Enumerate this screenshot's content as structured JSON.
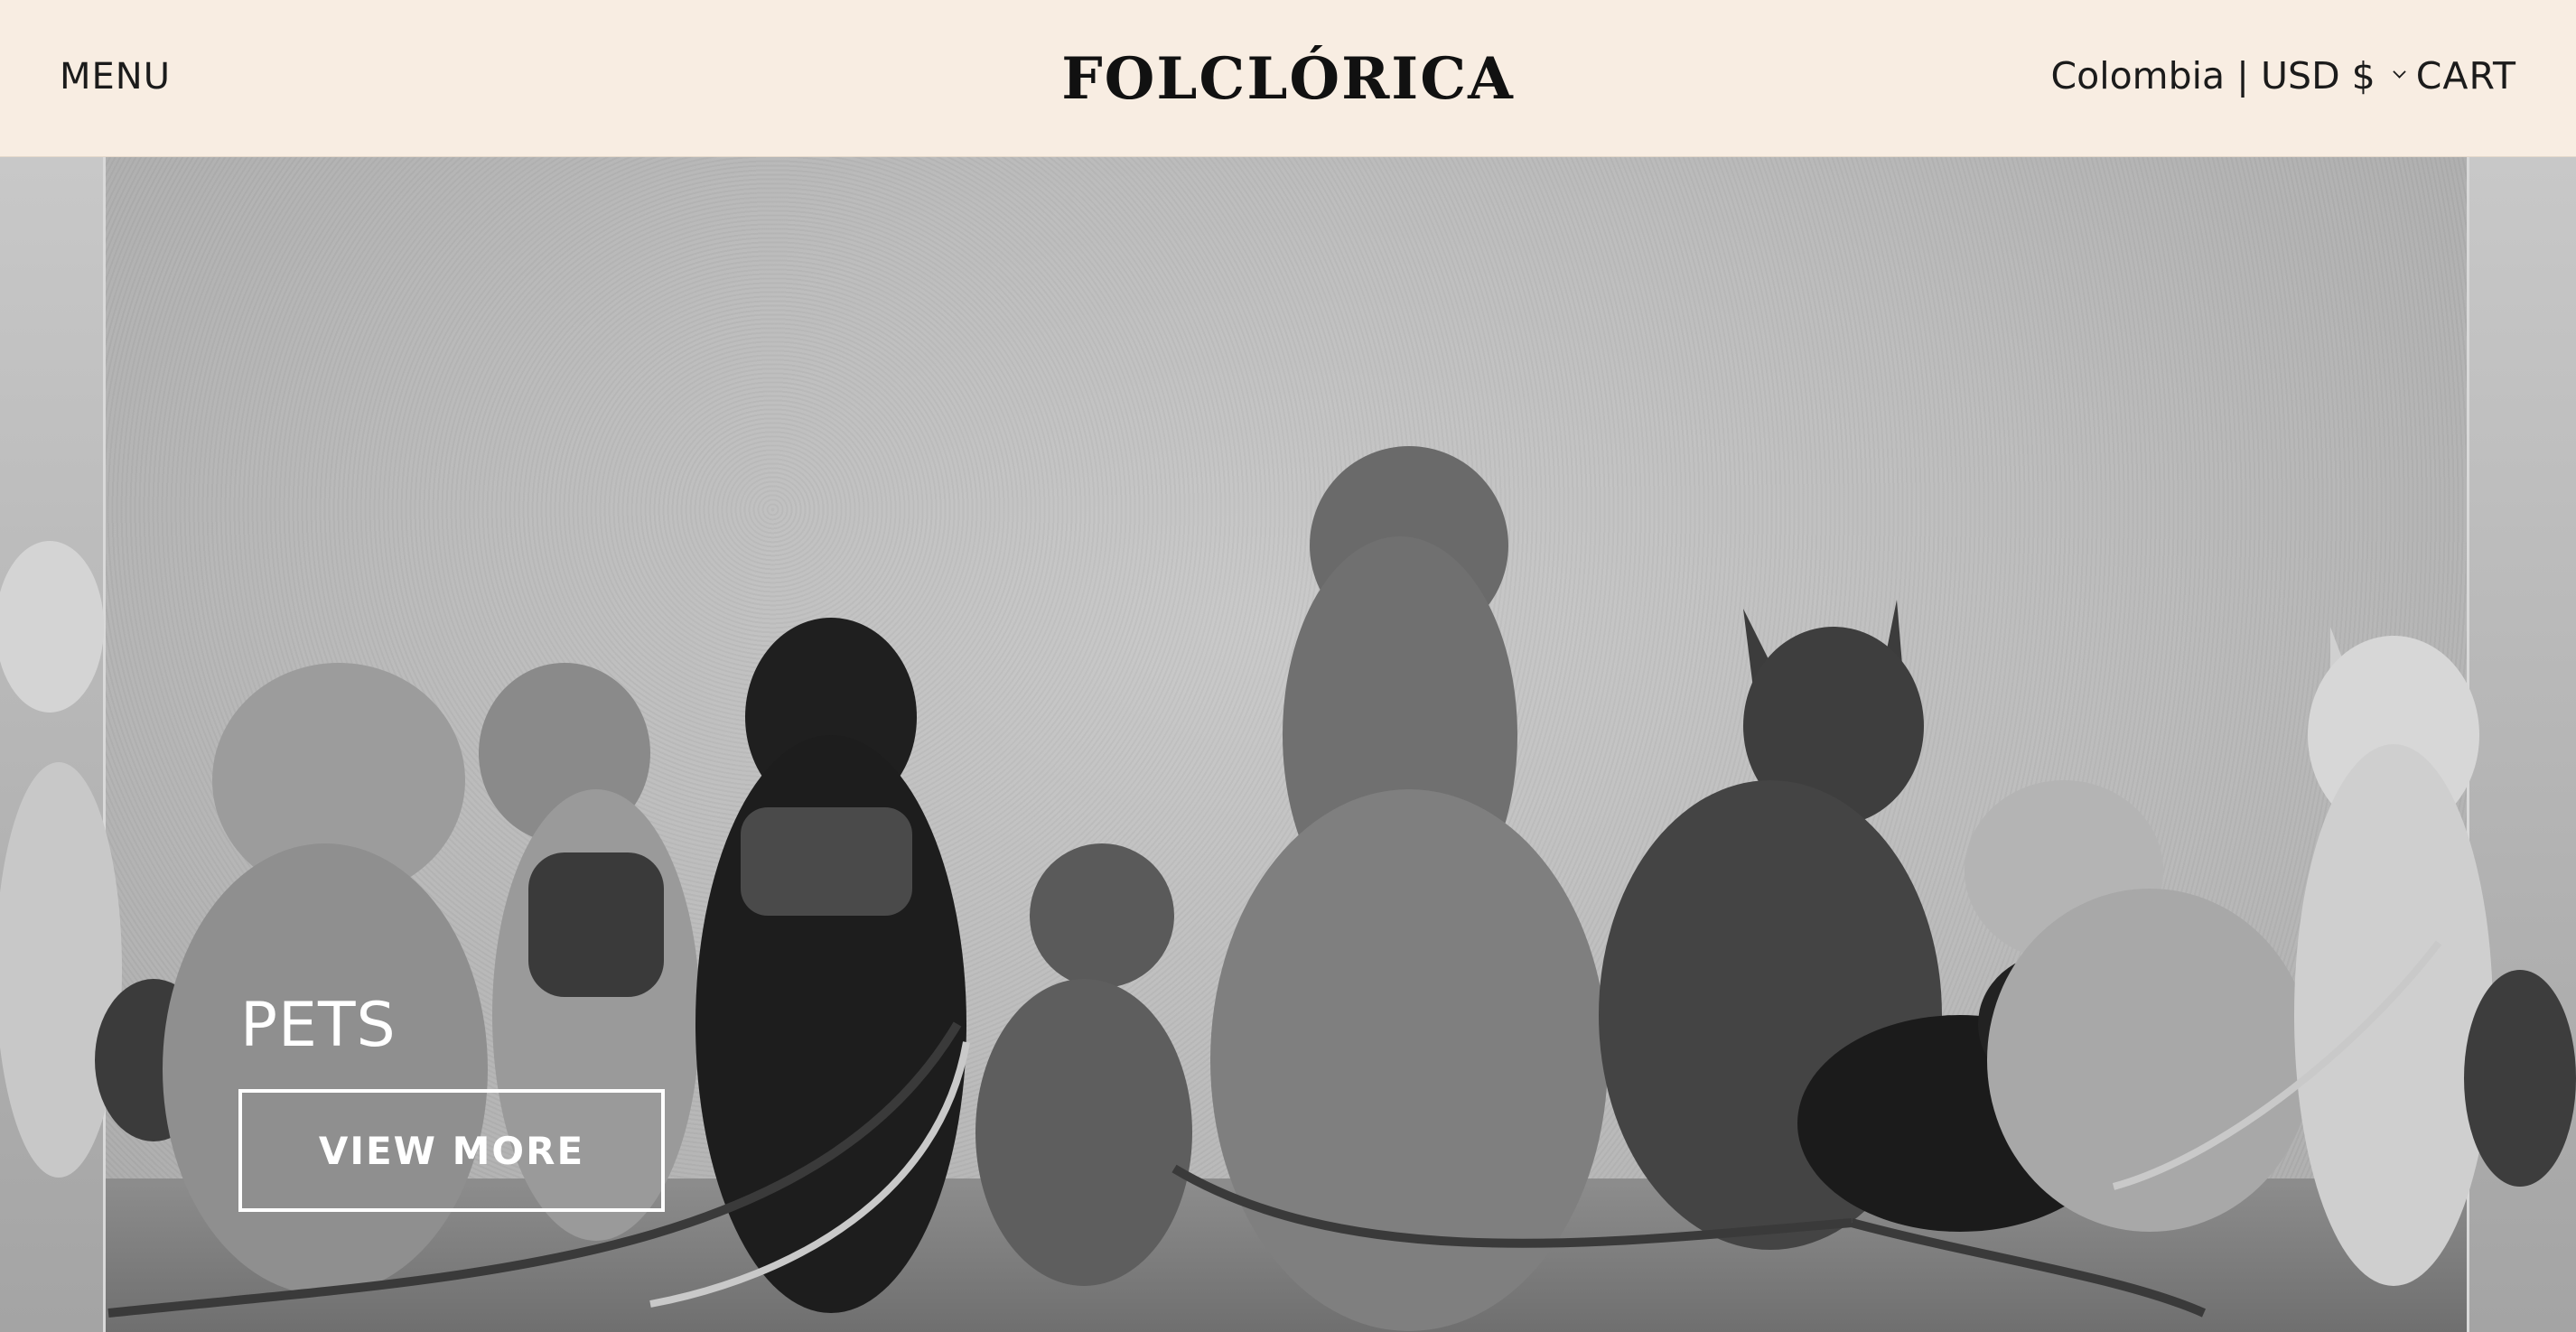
{
  "header": {
    "menu_label": "MENU",
    "logo_text": "FOLCLÓRICA",
    "locale_label": "Colombia | USD $",
    "cart_label": "CART"
  },
  "hero": {
    "title": "PETS",
    "cta_label": "VIEW MORE",
    "icon_names": [
      "chevron-down-icon"
    ]
  },
  "colors": {
    "header_background": "#f8ede2",
    "text_dark": "#1b1b1b",
    "hero_text": "#ffffff"
  }
}
